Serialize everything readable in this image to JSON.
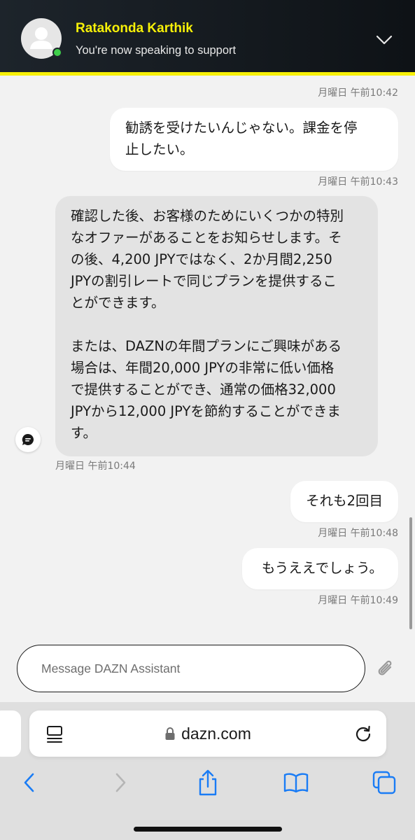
{
  "header": {
    "agent_name": "Ratakonda Karthik",
    "status": "You're now speaking to support"
  },
  "messages": [
    {
      "type": "timestamp",
      "text": "月曜日 午前10:42"
    },
    {
      "type": "outgoing",
      "text": "勧誘を受けたいんじゃない。課金を停\n止したい。"
    },
    {
      "type": "timestamp",
      "text": "月曜日 午前10:43"
    },
    {
      "type": "incoming",
      "text": "確認した後、お客様のためにいくつかの特別\nなオファーがあることをお知らせします。そ\nの後、4,200 JPYではなく、2か月間2,250\nJPYの割引レートで同じプランを提供するこ\nとができます。\n\nまたは、DAZNの年間プランにご興味がある\n場合は、年間20,000 JPYの非常に低い価格\nで提供することができ、通常の価格32,000\nJPYから12,000 JPYを節約することができま\nす。"
    },
    {
      "type": "timestamp",
      "text": "月曜日 午前10:44"
    },
    {
      "type": "outgoing",
      "text": "それも2回目"
    },
    {
      "type": "timestamp",
      "text": "月曜日 午前10:48"
    },
    {
      "type": "outgoing",
      "text": "もうええでしょう。"
    },
    {
      "type": "timestamp",
      "text": "月曜日 午前10:49"
    }
  ],
  "composer": {
    "placeholder": "Message DAZN Assistant",
    "value": ""
  },
  "browser": {
    "url": "dazn.com"
  },
  "icons": {
    "collapse": "chevron-down-icon",
    "attach": "paperclip-icon",
    "bot": "chat-bubble-icon",
    "reader": "reader-mode-icon",
    "lock": "lock-icon",
    "reload": "reload-icon",
    "back": "back-arrow-icon",
    "forward": "forward-arrow-icon",
    "share": "share-icon",
    "bookmarks": "bookmarks-icon",
    "tabs": "tabs-icon"
  },
  "colors": {
    "accent": "#f7f008",
    "header_bg": "#1d242b",
    "online": "#3ecf4a",
    "ios_blue": "#1a7cf5"
  }
}
